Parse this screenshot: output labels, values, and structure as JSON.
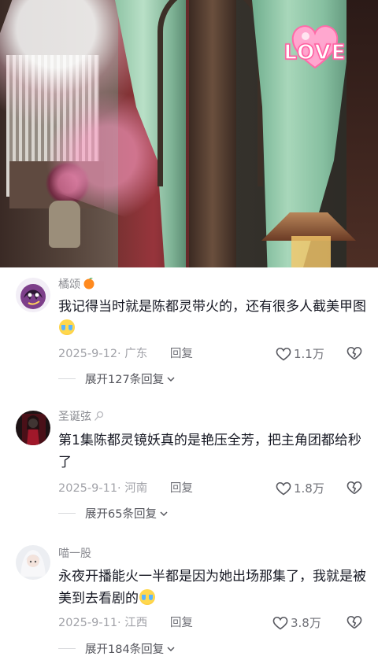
{
  "video": {
    "sticker_text": "LOVE"
  },
  "comments": [
    {
      "username": "橘颂",
      "badge_icon": "orange-emoji-icon",
      "text": "我记得当时就是陈都灵带火的，还有很多人截美甲图",
      "text_emoji": "crying-emoji-icon",
      "date": "2025-9-12",
      "location": "· 广东",
      "reply_label": "回复",
      "likes": "1.1万",
      "expand_label": "展开127条回复"
    },
    {
      "username": "圣诞弦",
      "badge_icon": "lollipop-icon",
      "text": "第1集陈都灵镜妖真的是艳压全芳，把主角团都给秒了",
      "date": "2025-9-11",
      "location": "· 河南",
      "reply_label": "回复",
      "likes": "1.8万",
      "expand_label": "展开65条回复"
    },
    {
      "username": "喵一股",
      "text": "永夜开播能火一半都是因为她出场那集了，我就是被美到去看剧的",
      "text_emoji": "crying-emoji-icon",
      "date": "2025-9-11",
      "location": "· 江西",
      "reply_label": "回复",
      "likes": "3.8万",
      "expand_label": "展开184条回复"
    }
  ],
  "colors": {
    "primary_text": "#161823",
    "secondary_text": "#a1a2a8",
    "love_pink": "#ff8fc0"
  }
}
